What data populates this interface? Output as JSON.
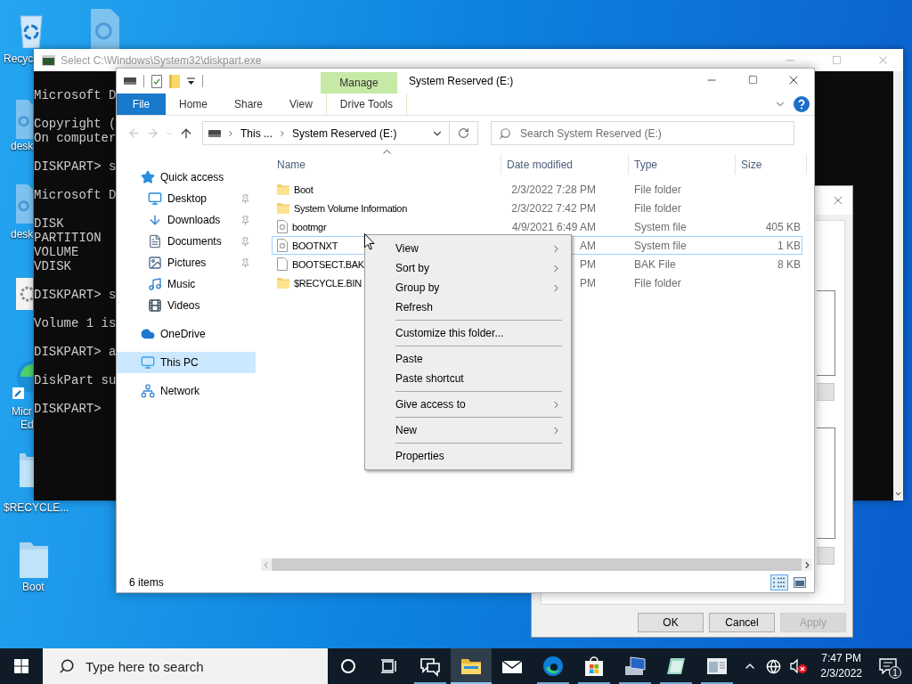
{
  "desktop": {
    "icons": [
      {
        "kind": "recycle",
        "lines": [
          "Recyc"
        ]
      },
      {
        "kind": "settings-file"
      },
      {
        "kind": "settings-file",
        "lines": [
          "desk"
        ]
      },
      {
        "kind": "settings-file",
        "lines": [
          "desk"
        ]
      },
      {
        "kind": "settings-box"
      },
      {
        "kind": "edge",
        "lines": [
          "Micr",
          "Ed"
        ]
      },
      {
        "kind": "folder",
        "lines": [
          "$RECYCLE..."
        ]
      },
      {
        "kind": "folder",
        "lines": [
          "Boot"
        ]
      }
    ]
  },
  "console": {
    "title": "Select C:\\Windows\\System32\\diskpart.exe",
    "blocks": [
      [
        "Microsoft D"
      ],
      [
        "Copyright (",
        "On computer"
      ],
      [
        "DISKPART> s"
      ],
      [
        "Microsoft D"
      ],
      [
        "DISK",
        "PARTITION",
        "VOLUME",
        "VDISK"
      ],
      [
        "DISKPART> s"
      ],
      [
        "Volume 1 is"
      ],
      [
        "DISKPART> a"
      ],
      [
        "DiskPart su"
      ],
      [
        "DISKPART>"
      ]
    ]
  },
  "properties": {
    "buttons": [
      {
        "label": "OK",
        "disabled": false
      },
      {
        "label": "Cancel",
        "disabled": false
      },
      {
        "label": "Apply",
        "disabled": true
      }
    ]
  },
  "explorer": {
    "title": "System Reserved (E:)",
    "contextual_tab": "Manage",
    "tabs": [
      {
        "label": "File",
        "kind": "file"
      },
      {
        "label": "Home",
        "kind": "tab"
      },
      {
        "label": "Share",
        "kind": "tab"
      },
      {
        "label": "View",
        "kind": "tab"
      },
      {
        "label": "Drive Tools",
        "kind": "contextual"
      }
    ],
    "address": [
      "This ...",
      "System Reserved (E:)"
    ],
    "search": {
      "placeholder": "Search System Reserved (E:)"
    },
    "nav": [
      {
        "label": "Quick access",
        "kind": "star",
        "selected": false,
        "children": [
          {
            "label": "Desktop",
            "kind": "desktop",
            "pinned": true,
            "selected": false
          },
          {
            "label": "Downloads",
            "kind": "downloads",
            "pinned": true,
            "selected": false
          },
          {
            "label": "Documents",
            "kind": "documents",
            "pinned": true,
            "selected": false
          },
          {
            "label": "Pictures",
            "kind": "pictures",
            "pinned": true,
            "selected": false
          },
          {
            "label": "Music",
            "kind": "music",
            "pinned": false,
            "selected": false
          },
          {
            "label": "Videos",
            "kind": "videos",
            "pinned": false,
            "selected": false
          }
        ]
      },
      {
        "label": "OneDrive",
        "kind": "cloud",
        "selected": false
      },
      {
        "label": "This PC",
        "kind": "pc",
        "selected": true
      },
      {
        "label": "Network",
        "kind": "network",
        "selected": false
      }
    ],
    "columns": [
      {
        "label": "Name",
        "sorted": true
      },
      {
        "label": "Date modified",
        "sorted": false
      },
      {
        "label": "Type",
        "sorted": false
      },
      {
        "label": "Size",
        "sorted": false
      }
    ],
    "rows": [
      {
        "kind": "folder",
        "name": "Boot",
        "date": "2/3/2022 7:28 PM",
        "type": "File folder",
        "focused": false
      },
      {
        "kind": "folder",
        "name": "System Volume Information",
        "date": "2/3/2022 7:42 PM",
        "type": "File folder",
        "focused": false
      },
      {
        "kind": "system",
        "name": "bootmgr",
        "date": "4/9/2021 6:49 AM",
        "type": "System file",
        "size": "405 KB",
        "focused": false
      },
      {
        "kind": "system",
        "name": "BOOTNXT",
        "date": "AM",
        "type": "System file",
        "size": "1 KB",
        "focused": true
      },
      {
        "kind": "file",
        "name": "BOOTSECT.BAK",
        "date": "PM",
        "type": "BAK File",
        "size": "8 KB",
        "focused": false
      },
      {
        "kind": "folder",
        "name": "$RECYCLE.BIN",
        "date": "PM",
        "type": "File folder",
        "focused": false
      }
    ],
    "status": "6 items",
    "views": [
      {
        "kind": "details",
        "selected": true
      },
      {
        "kind": "tiles",
        "selected": false
      }
    ]
  },
  "context_menu": {
    "items": [
      {
        "kind": "item",
        "label": "View",
        "submenu": true
      },
      {
        "kind": "item",
        "label": "Sort by",
        "submenu": true
      },
      {
        "kind": "item",
        "label": "Group by",
        "submenu": true
      },
      {
        "kind": "item",
        "label": "Refresh",
        "submenu": false
      },
      {
        "kind": "separator"
      },
      {
        "kind": "item",
        "label": "Customize this folder...",
        "submenu": false
      },
      {
        "kind": "separator"
      },
      {
        "kind": "item",
        "label": "Paste",
        "submenu": false
      },
      {
        "kind": "item",
        "label": "Paste shortcut",
        "submenu": false
      },
      {
        "kind": "separator"
      },
      {
        "kind": "item",
        "label": "Give access to",
        "submenu": true
      },
      {
        "kind": "separator"
      },
      {
        "kind": "item",
        "label": "New",
        "submenu": true
      },
      {
        "kind": "separator"
      },
      {
        "kind": "item",
        "label": "Properties",
        "submenu": false
      }
    ]
  },
  "taskbar": {
    "search_placeholder": "Type here to search",
    "apps": [
      {
        "kind": "cortana",
        "running": false,
        "active": false
      },
      {
        "kind": "taskview",
        "running": false,
        "active": false
      },
      {
        "kind": "feedback",
        "running": true,
        "active": false
      },
      {
        "kind": "explorer",
        "running": true,
        "active": true
      },
      {
        "kind": "mail",
        "running": false,
        "active": false
      },
      {
        "kind": "edge",
        "running": true,
        "active": false
      },
      {
        "kind": "store",
        "running": true,
        "active": false
      },
      {
        "kind": "computer",
        "running": true,
        "active": false
      },
      {
        "kind": "notepad",
        "running": true,
        "active": false
      },
      {
        "kind": "window",
        "running": true,
        "active": false
      }
    ],
    "time": "7:47 PM",
    "date": "2/3/2022",
    "notifications": "1"
  }
}
